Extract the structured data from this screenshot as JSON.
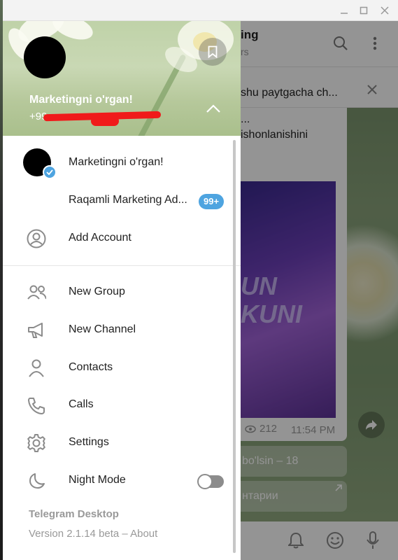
{
  "window": {
    "controls": [
      "minimize",
      "maximize",
      "close"
    ]
  },
  "chat": {
    "title": "ing",
    "subtitle": "rs",
    "pinned_text": "shu paytgacha ch...",
    "message_lines": [
      "...",
      "ishonlanishini"
    ],
    "media_text_line1": "UN",
    "media_text_line2": "KUNI",
    "views": "212",
    "time": "11:54 PM",
    "reply_button_1": "bo'lsin – 18",
    "reply_button_2": "нтарии"
  },
  "drawer": {
    "profile_name": "Marketingni o'rgan!",
    "profile_phone": "+99",
    "accounts": [
      {
        "label": "Marketingni o'rgan!",
        "verified": true
      },
      {
        "label": "Raqamli Marketing Ad...",
        "badge": "99+"
      },
      {
        "label": "Add Account",
        "icon": "add-account-icon"
      }
    ],
    "menu": [
      {
        "label": "New Group",
        "icon": "people-icon"
      },
      {
        "label": "New Channel",
        "icon": "megaphone-icon"
      },
      {
        "label": "Contacts",
        "icon": "user-icon"
      },
      {
        "label": "Calls",
        "icon": "phone-icon"
      },
      {
        "label": "Settings",
        "icon": "gear-icon"
      },
      {
        "label": "Night Mode",
        "icon": "moon-icon",
        "toggle": false
      }
    ],
    "footer_name": "Telegram Desktop",
    "footer_version": "Version 2.1.14 beta – About"
  },
  "colors": {
    "accent": "#4ea4e0",
    "redaction": "#f01a1a",
    "icon_gray": "#8b8b8b"
  }
}
